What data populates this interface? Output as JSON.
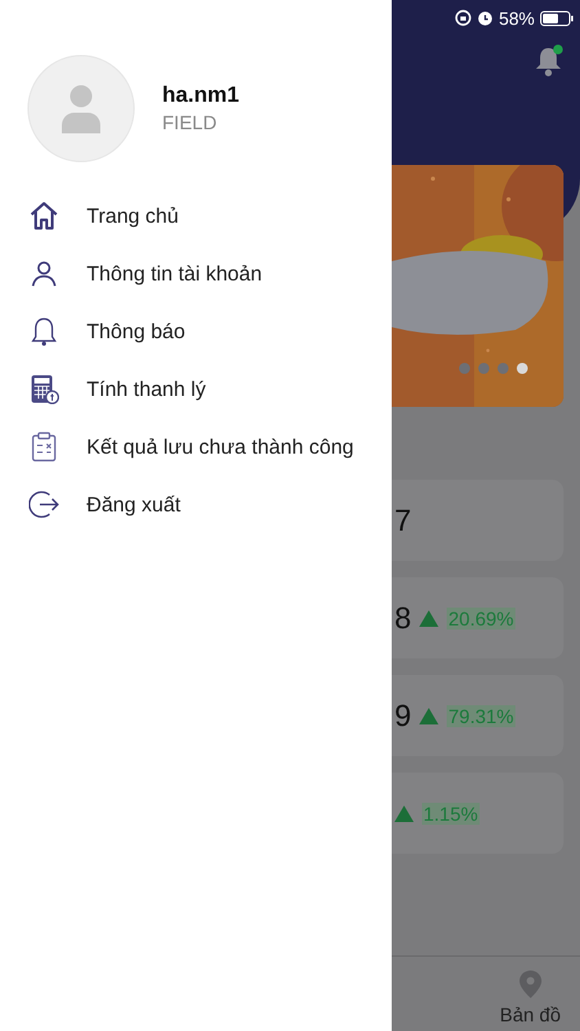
{
  "status_bar": {
    "battery_text": "58%"
  },
  "header": {
    "notification_dot": true
  },
  "banner": {
    "kind": "picture",
    "dots": [
      {
        "selected": false
      },
      {
        "selected": false
      },
      {
        "selected": false
      },
      {
        "selected": true
      }
    ]
  },
  "stat_cards": [
    {
      "value": "7"
    },
    {
      "value": "8",
      "change": "20.69%"
    },
    {
      "value": "9",
      "change": "79.31%"
    },
    {
      "change": "1.15%"
    }
  ],
  "tab_bar": [
    {
      "label": "Bản đồ"
    }
  ],
  "drawer": {
    "user": {
      "name": "ha.nm1",
      "role": "FIELD"
    },
    "menu": [
      {
        "label": "Trang chủ"
      },
      {
        "label": "Thông tin tài khoản"
      },
      {
        "label": "Thông báo"
      },
      {
        "label": "Tính thanh lý"
      },
      {
        "label": "Kết quả lưu chưa thành công"
      },
      {
        "label": "Đăng xuất"
      }
    ]
  }
}
